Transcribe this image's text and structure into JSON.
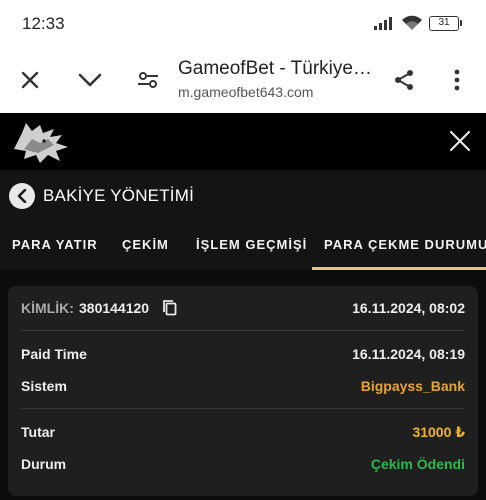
{
  "status_bar": {
    "time": "12:33",
    "battery": "31",
    "icons": [
      "signal-icon",
      "wifi-icon",
      "battery-icon"
    ]
  },
  "browser": {
    "title": "GameofBet - Türkiye…",
    "url": "m.gameofbet643.com",
    "icons": [
      "close-icon",
      "chevron-down-icon",
      "tune-icon",
      "share-icon",
      "more-vert-icon"
    ]
  },
  "header": {
    "logo": "wolf-logo",
    "heading": "BAKİYE YÖNETİMİ"
  },
  "tabs": [
    {
      "label": "PARA YATIR"
    },
    {
      "label": "ÇEKİM"
    },
    {
      "label": "İŞLEM GEÇMİŞİ"
    },
    {
      "label": "PARA ÇEKME DURUMU",
      "active": true
    }
  ],
  "withdrawal": {
    "id_label": "KİMLİK:",
    "id_value": "380144120",
    "created": "16.11.2024, 08:02",
    "paid_time_label": "Paid Time",
    "paid_time": "16.11.2024, 08:19",
    "system_label": "Sistem",
    "system": "Bigpayss_Bank",
    "amount_label": "Tutar",
    "amount": "31000 ₺",
    "status_label": "Durum",
    "status": "Çekim Ödendi"
  },
  "colors": {
    "accent": "#e9c46a",
    "system": "#e6a532",
    "amount": "#f0b429",
    "status": "#2db84b"
  }
}
